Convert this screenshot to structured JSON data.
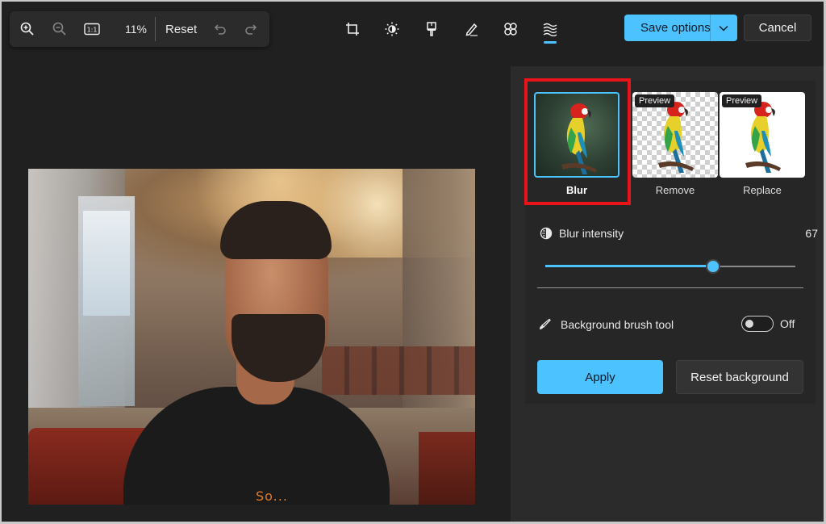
{
  "toolbar": {
    "zoom_in_icon": "zoom-in-icon",
    "zoom_out_icon": "zoom-out-icon",
    "actual_size_label": "1:1",
    "zoom_percent": "11%",
    "reset_label": "Reset"
  },
  "tools": [
    {
      "name": "crop-icon"
    },
    {
      "name": "brightness-icon"
    },
    {
      "name": "filter-icon"
    },
    {
      "name": "markup-icon"
    },
    {
      "name": "retouch-icon"
    },
    {
      "name": "background-icon",
      "active": true
    }
  ],
  "header": {
    "save_label": "Save options",
    "cancel_label": "Cancel"
  },
  "photo": {
    "shirt_print": "So..."
  },
  "panel": {
    "presets": [
      {
        "label": "Blur",
        "selected": true
      },
      {
        "label": "Remove",
        "badge": "Preview"
      },
      {
        "label": "Replace",
        "badge": "Preview"
      }
    ],
    "intensity_label": "Blur intensity",
    "intensity_value": "67",
    "intensity_fraction": 0.67,
    "brush_label": "Background brush tool",
    "brush_state": "Off",
    "apply_label": "Apply",
    "reset_bg_label": "Reset background"
  },
  "colors": {
    "accent": "#4cc2ff",
    "highlight_box": "#e8141a",
    "background": "#202020"
  }
}
